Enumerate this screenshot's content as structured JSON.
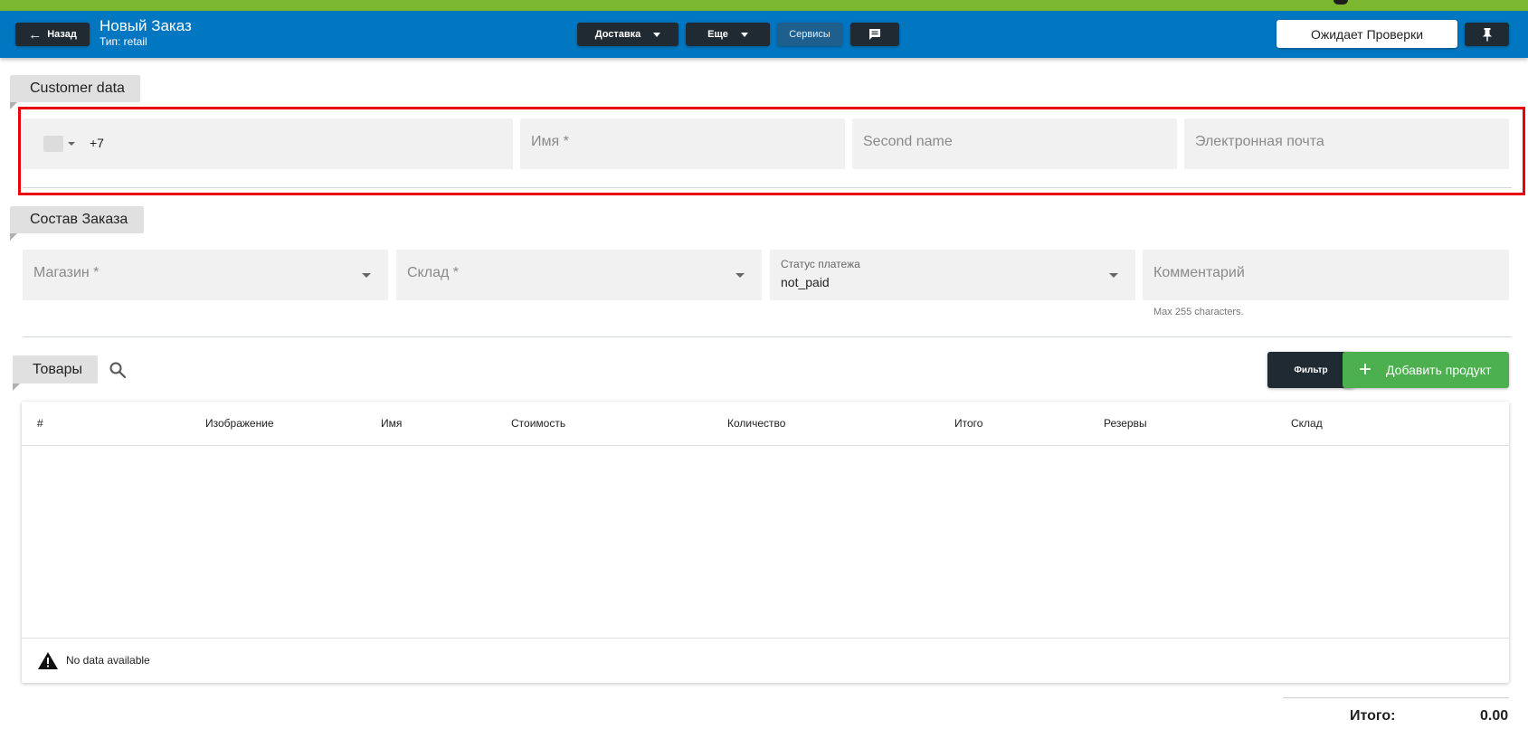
{
  "header": {
    "back_label": "Назад",
    "title": "Новый Заказ",
    "subtitle": "Тип: retail",
    "delivery_label": "Доставка",
    "more_label": "Еще",
    "services_label": "Сервисы",
    "status_label": "Ожидает Проверки",
    "bg_color": "#0277c1",
    "strip_color": "#7cb82f"
  },
  "customer": {
    "section_label": "Customer data",
    "phone_value": "+7",
    "name_placeholder": "Имя *",
    "second_name_placeholder": "Second name",
    "email_placeholder": "Электронная почта"
  },
  "order": {
    "section_label": "Состав Заказа",
    "store_placeholder": "Магазин *",
    "warehouse_placeholder": "Склад *",
    "payment_status_label": "Статус платежа",
    "payment_status_value": "not_paid",
    "comment_placeholder": "Комментарий",
    "comment_hint": "Max 255 characters."
  },
  "products": {
    "section_label": "Товары",
    "filter_label": "Фильтр",
    "add_label": "Добавить продукт",
    "add_color": "#4caf50",
    "columns": [
      "#",
      "Изображение",
      "Имя",
      "Стоимость",
      "Количество",
      "Итого",
      "Резервы",
      "Склад"
    ],
    "empty_text": "No data available"
  },
  "totals": {
    "label": "Итого:",
    "value": "0.00"
  }
}
